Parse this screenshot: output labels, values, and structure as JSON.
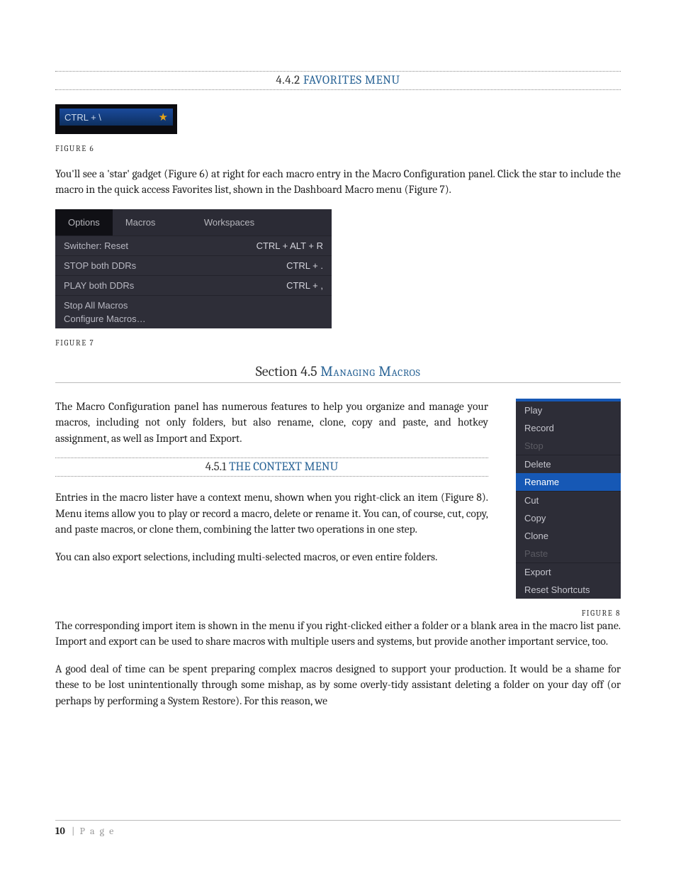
{
  "heading_442": {
    "num": "4.4.2",
    "title": "FAVORITES MENU"
  },
  "fig6": {
    "shortcut": "CTRL + \\",
    "caption": "FIGURE 6"
  },
  "para1": "You'll see a 'star' gadget (Figure 6) at right for each macro entry in the Macro Configuration panel.  Click the star to include the macro in the quick access Favorites list, shown in the Dashboard Macro menu (Figure 7).",
  "fig7": {
    "tabs": {
      "options": "Options",
      "macros": "Macros",
      "workspaces": "Workspaces"
    },
    "rows": [
      {
        "label": "Switcher: Reset",
        "shortcut": "CTRL + ALT + R"
      },
      {
        "label": "STOP both DDRs",
        "shortcut": "CTRL + ."
      },
      {
        "label": "PLAY both DDRs",
        "shortcut": "CTRL + ,"
      },
      {
        "label": "Stop All Macros",
        "shortcut": ""
      },
      {
        "label": "Configure Macros…",
        "shortcut": ""
      }
    ],
    "caption": "FIGURE 7"
  },
  "section_45": {
    "prefix": "Section 4.5",
    "title": "Managing Macros"
  },
  "para2": "The Macro Configuration panel has numerous features to help you organize and manage your macros, including not only folders, but also rename, clone, copy and paste, and hotkey assignment, as well as Import and Export.",
  "heading_451": {
    "num": "4.5.1",
    "title": "THE CONTEXT MENU"
  },
  "para3": "Entries in the macro lister have a context menu, shown when you right-click an item (Figure 8).  Menu items allow you to play or record a macro, delete or rename it.  You can, of course, cut, copy, and paste macros, or clone them, combining the latter two operations in one step.",
  "para4": "You can also export selections, including multi-selected macros, or even entire folders.",
  "para5": "The corresponding import item is shown in the menu if you right-clicked either a folder or a blank area in the macro list pane. Import and export can be used to share macros with multiple users and systems, but provide another important service, too.",
  "para6": "A good deal of time can be spent preparing complex macros designed to support your production.  It would be a shame for these to be lost unintentionally through some mishap, as by some overly-tidy assistant deleting a folder on your day off (or perhaps by performing a System Restore).   For this reason, we",
  "ctx": {
    "play": "Play",
    "record": "Record",
    "stop": "Stop",
    "delete": "Delete",
    "rename": "Rename",
    "cut": "Cut",
    "copy": "Copy",
    "clone": "Clone",
    "paste": "Paste",
    "export": "Export",
    "reset": "Reset Shortcuts",
    "caption": "FIGURE 8"
  },
  "footer": {
    "page_number": "10",
    "page_word": "P a g e",
    "sep": " | "
  }
}
